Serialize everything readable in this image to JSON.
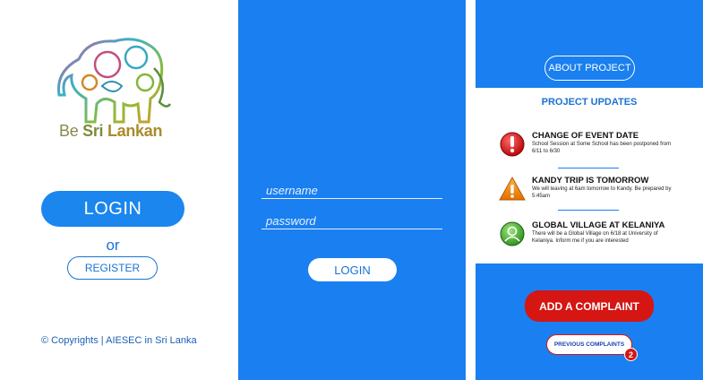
{
  "screen1": {
    "logo_be": "Be ",
    "logo_sri": "Sri ",
    "logo_lankan": "Lankan",
    "login_label": "LOGIN",
    "or_label": "or",
    "register_label": "REGISTER",
    "copyright": "© Copyrights | AIESEC in Sri Lanka"
  },
  "screen2": {
    "username_placeholder": "username",
    "password_placeholder": "password",
    "login_label": "LOGIN"
  },
  "screen3": {
    "about_label": "ABOUT PROJECT",
    "updates_title": "PROJECT UPDATES",
    "updates": [
      {
        "icon": "error-icon",
        "title": "CHANGE OF EVENT DATE",
        "desc": "School Session at Some School has been postponed from 6/11 to 6/30"
      },
      {
        "icon": "warning-icon",
        "title": "KANDY TRIP IS TOMORROW",
        "desc": "We will leaving at 6am tomorrow to Kandy. Be prepared by 5:45am"
      },
      {
        "icon": "user-icon",
        "title": "GLOBAL VILLAGE AT KELANIYA",
        "desc": "There will be a Global Village on 6/18 at University of Kelaniya. Inform me if you are interested"
      }
    ],
    "complaint_label": "ADD A COMPLAINT",
    "previous_label": "PREVIOUS COMPLAINTS",
    "badge_count": "2"
  },
  "colors": {
    "primary_blue": "#1a7ff0",
    "button_blue": "#1a86ee",
    "danger_red": "#d51612"
  }
}
